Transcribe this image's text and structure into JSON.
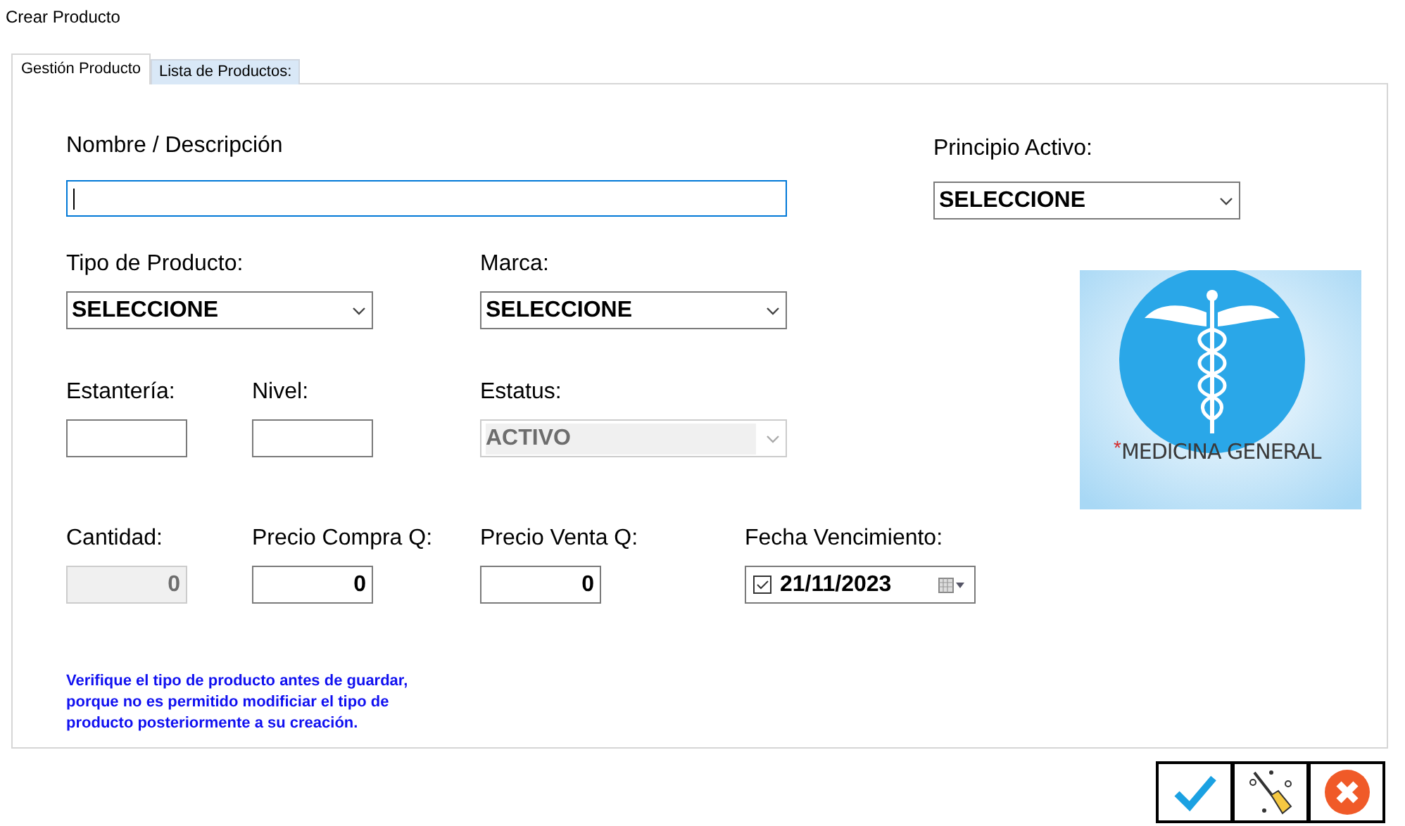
{
  "window": {
    "title": "Crear Producto"
  },
  "tabs": [
    {
      "label": "Gestión Producto",
      "selected": true
    },
    {
      "label": "Lista de Productos:",
      "selected": false
    }
  ],
  "rows": [
    [
      {
        "kind": "text",
        "label": "Nombre / Descripción",
        "focused": true,
        "disabled": false
      }
    ],
    [
      {
        "kind": "select",
        "label": "Tipo de Producto:",
        "value": "SELECCIONE",
        "focused": false,
        "disabled": false
      },
      {
        "kind": "select",
        "label": "Marca:",
        "value": "SELECCIONE",
        "focused": false,
        "disabled": false
      }
    ],
    [
      {
        "kind": "text",
        "label": "Estantería:",
        "focused": false,
        "disabled": false
      },
      {
        "kind": "text",
        "label": "Nivel:",
        "focused": false,
        "disabled": false
      },
      {
        "kind": "select",
        "label": "Estatus:",
        "value": "ACTIVO",
        "focused": false,
        "disabled": true
      }
    ],
    [
      {
        "kind": "text",
        "label": "Cantidad:",
        "value": "0",
        "focused": false,
        "disabled": true
      },
      {
        "kind": "text",
        "label": "Precio Compra Q:",
        "value": "0",
        "focused": false,
        "disabled": false
      },
      {
        "kind": "text",
        "label": "Precio Venta Q:",
        "value": "0",
        "focused": false,
        "disabled": false
      },
      {
        "kind": "date",
        "label": "Fecha Vencimiento:",
        "value": "21/11/2023",
        "checked": true,
        "focused": false,
        "disabled": false
      }
    ]
  ],
  "side_field": {
    "kind": "select",
    "label": "Principio Activo:",
    "value": "SELECCIONE",
    "focused": false,
    "disabled": false
  },
  "logo": {
    "mark": "*",
    "caption": "MEDICINA GENERAL"
  },
  "note": "Verifique el tipo de producto antes de guardar, porque no es permitido modificiar el tipo de producto posteriormente a su creación.",
  "buttons": [
    {
      "kind": "save"
    },
    {
      "kind": "clear"
    },
    {
      "kind": "cancel"
    }
  ]
}
